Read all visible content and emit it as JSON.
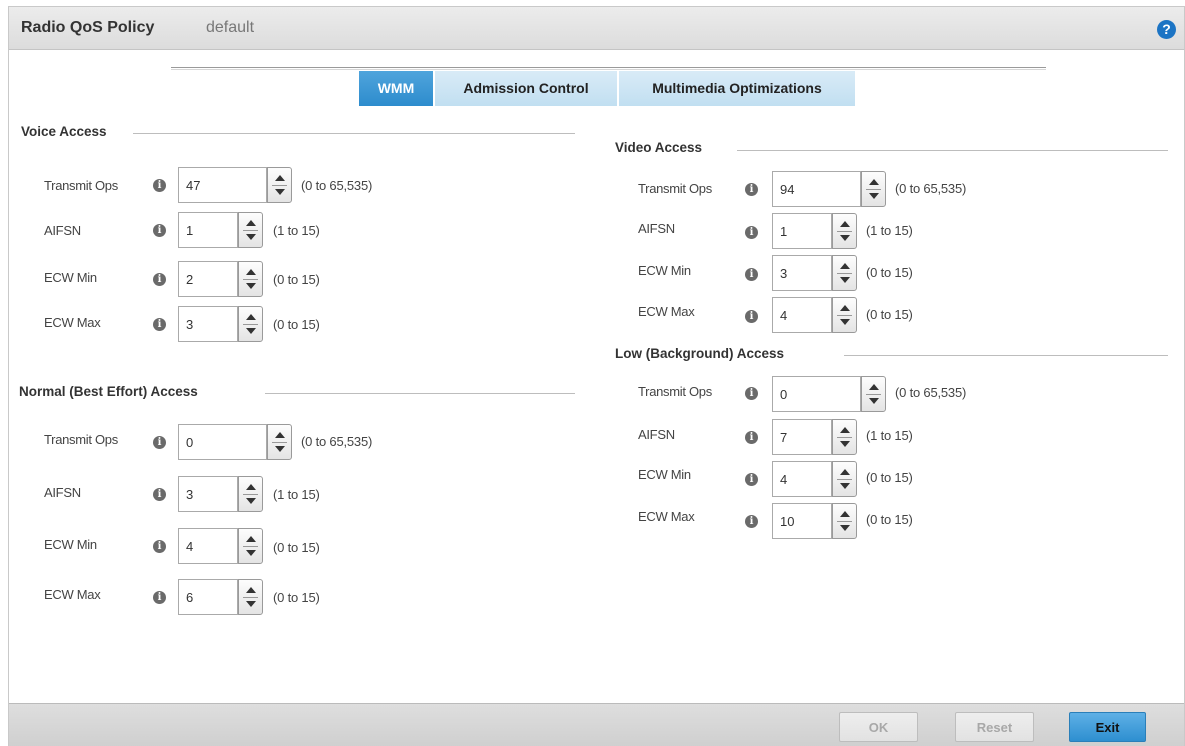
{
  "header": {
    "title": "Radio QoS Policy",
    "subtitle": "default",
    "help": "?"
  },
  "tabs": [
    {
      "label": "WMM",
      "active": true
    },
    {
      "label": "Admission Control",
      "active": false
    },
    {
      "label": "Multimedia Optimizations",
      "active": false
    }
  ],
  "voice": {
    "title": "Voice Access",
    "transmit_ops": {
      "label": "Transmit Ops",
      "value": "47",
      "range": "(0 to 65,535)"
    },
    "aifsn": {
      "label": "AIFSN",
      "value": "1",
      "range": "(1 to 15)"
    },
    "ecw_min": {
      "label": "ECW Min",
      "value": "2",
      "range": "(0 to 15)"
    },
    "ecw_max": {
      "label": "ECW Max",
      "value": "3",
      "range": "(0 to 15)"
    }
  },
  "normal": {
    "title": "Normal (Best Effort) Access",
    "transmit_ops": {
      "label": "Transmit Ops",
      "value": "0",
      "range": "(0 to 65,535)"
    },
    "aifsn": {
      "label": "AIFSN",
      "value": "3",
      "range": "(1 to 15)"
    },
    "ecw_min": {
      "label": "ECW Min",
      "value": "4",
      "range": "(0 to 15)"
    },
    "ecw_max": {
      "label": "ECW Max",
      "value": "6",
      "range": "(0 to 15)"
    }
  },
  "video": {
    "title": "Video Access",
    "transmit_ops": {
      "label": "Transmit Ops",
      "value": "94",
      "range": "(0 to 65,535)"
    },
    "aifsn": {
      "label": "AIFSN",
      "value": "1",
      "range": "(1 to 15)"
    },
    "ecw_min": {
      "label": "ECW Min",
      "value": "3",
      "range": "(0 to 15)"
    },
    "ecw_max": {
      "label": "ECW Max",
      "value": "4",
      "range": "(0 to 15)"
    }
  },
  "low": {
    "title": "Low (Background) Access",
    "transmit_ops": {
      "label": "Transmit Ops",
      "value": "0",
      "range": "(0 to 65,535)"
    },
    "aifsn": {
      "label": "AIFSN",
      "value": "7",
      "range": "(1 to 15)"
    },
    "ecw_min": {
      "label": "ECW Min",
      "value": "4",
      "range": "(0 to 15)"
    },
    "ecw_max": {
      "label": "ECW Max",
      "value": "10",
      "range": "(0 to 15)"
    }
  },
  "footer": {
    "ok": "OK",
    "reset": "Reset",
    "exit": "Exit"
  },
  "colors": {
    "accent": "#2d8ccd",
    "tab_inactive": "#c1dff1",
    "info_icon": "#6a6a6a"
  },
  "icons": {
    "help": "help-icon",
    "info": "info-icon"
  }
}
